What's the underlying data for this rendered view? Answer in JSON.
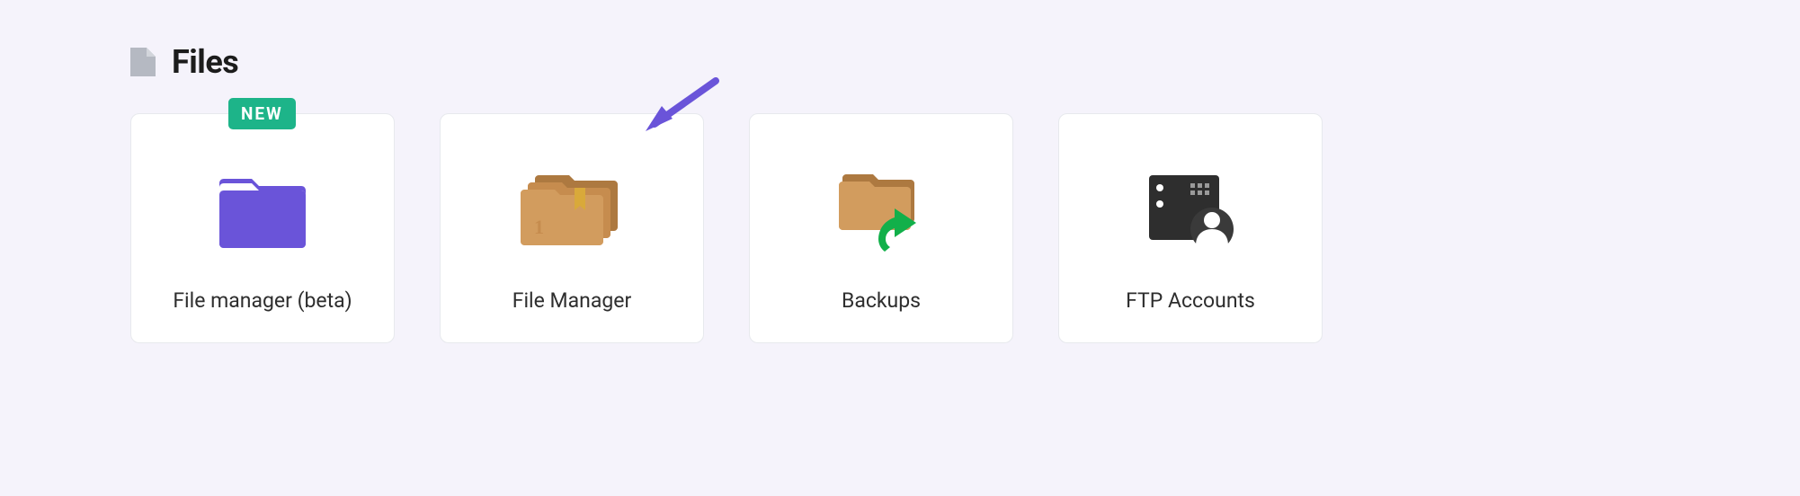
{
  "section": {
    "title": "Files"
  },
  "cards": [
    {
      "label": "File manager (beta)",
      "badge": "NEW"
    },
    {
      "label": "File Manager"
    },
    {
      "label": "Backups"
    },
    {
      "label": "FTP Accounts"
    }
  ]
}
